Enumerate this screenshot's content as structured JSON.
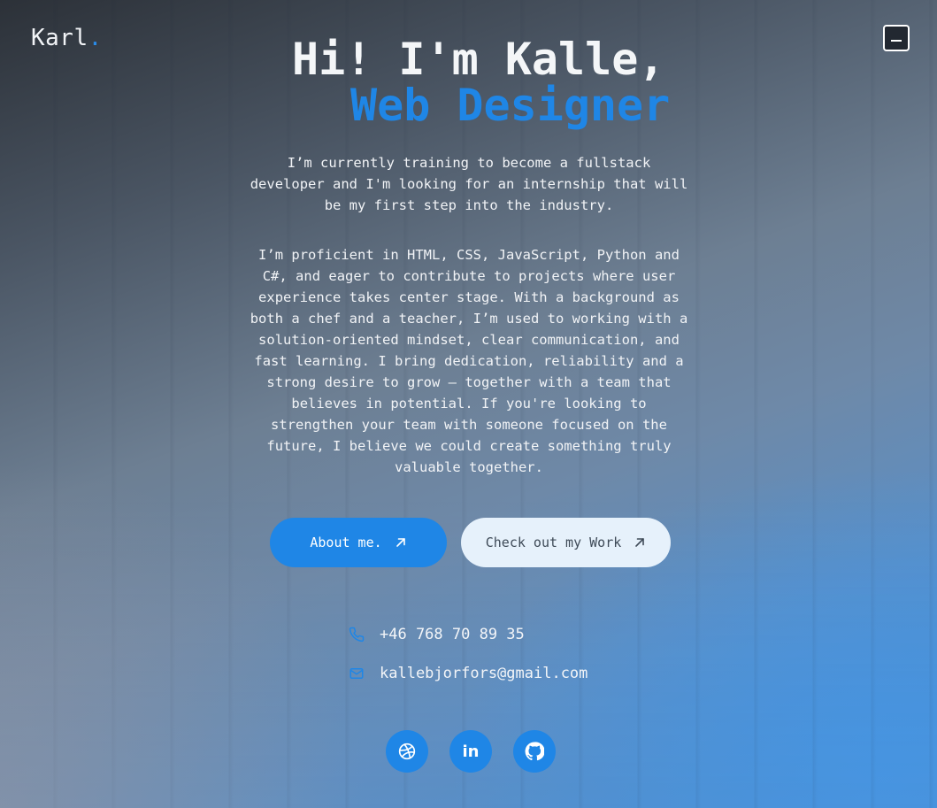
{
  "brand": {
    "name": "Karl",
    "dot": "."
  },
  "header": {
    "menu_icon": "menu-icon"
  },
  "hero": {
    "title_line1": "Hi! I'm Kalle,",
    "title_line2": "Web Designer",
    "paragraph1": "I’m currently training to become a fullstack developer and I'm looking for an internship that will be my first step into the industry.",
    "paragraph2": "I’m proficient in HTML, CSS, JavaScript, Python and C#, and eager to contribute to projects where user experience takes center stage. With a background as both a chef and a teacher, I’m used to working with a solution-oriented mindset, clear communication, and fast learning. I bring dedication, reliability and a strong desire to grow – together with a team that believes in potential. If you're looking to strengthen your team with someone focused on the future, I believe we could create something truly valuable together."
  },
  "buttons": {
    "about_label": "About me.",
    "work_label": "Check out my Work"
  },
  "contact": {
    "phone": "+46 768 70 89 35",
    "email": "kallebjorfors@gmail.com"
  },
  "socials": {
    "linkedin_text": "in"
  },
  "colors": {
    "accent": "#1f86e6",
    "light_button": "#e6f1fb"
  }
}
